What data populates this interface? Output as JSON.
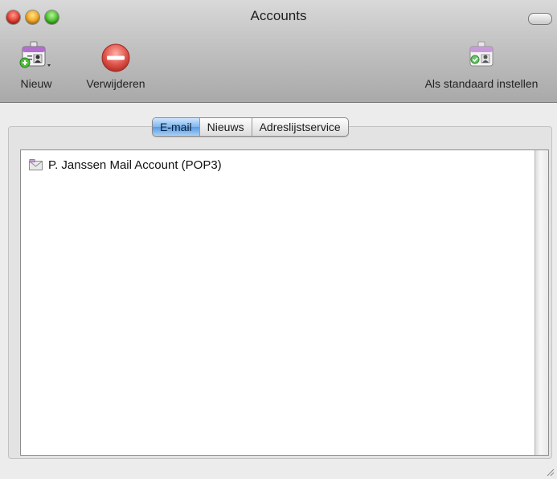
{
  "window": {
    "title": "Accounts"
  },
  "toolbar": {
    "new_label": "Nieuw",
    "delete_label": "Verwijderen",
    "set_default_label": "Als standaard instellen"
  },
  "tabs": [
    {
      "label": "E-mail",
      "active": true
    },
    {
      "label": "Nieuws",
      "active": false
    },
    {
      "label": "Adreslijstservice",
      "active": false
    }
  ],
  "accounts": [
    {
      "label": "P. Janssen Mail Account (POP3)",
      "icon": "mail-account-icon"
    }
  ],
  "colors": {
    "close": "#e0392b",
    "minimize": "#f1a51f",
    "zoom": "#48bf2a",
    "delete": "#e05050",
    "tab_active": "#7fb6ee"
  }
}
